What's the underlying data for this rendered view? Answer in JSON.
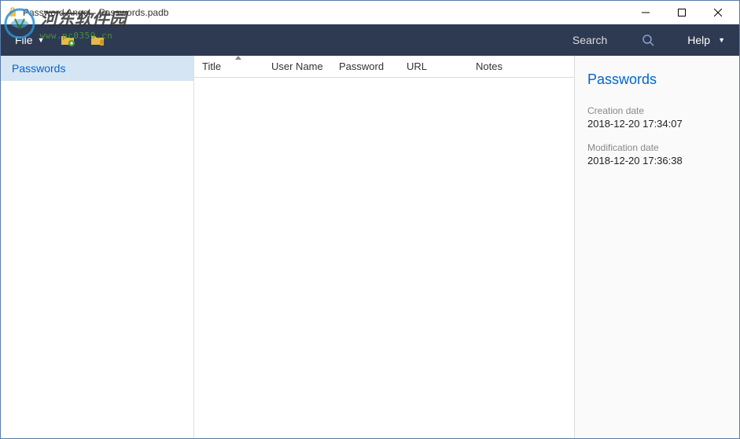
{
  "window": {
    "title": "Password Angel - Passwords.padb"
  },
  "toolbar": {
    "file_label": "File",
    "search_label": "Search",
    "help_label": "Help"
  },
  "sidebar": {
    "items": [
      {
        "label": "Passwords"
      }
    ]
  },
  "table": {
    "columns": {
      "title": "Title",
      "username": "User Name",
      "password": "Password",
      "url": "URL",
      "notes": "Notes"
    }
  },
  "details": {
    "title": "Passwords",
    "creation_label": "Creation date",
    "creation_value": "2018-12-20 17:34:07",
    "modification_label": "Modification date",
    "modification_value": "2018-12-20 17:36:38"
  },
  "watermark": {
    "cn_text": "河东软件园",
    "url": "www.pc0359.cn"
  }
}
